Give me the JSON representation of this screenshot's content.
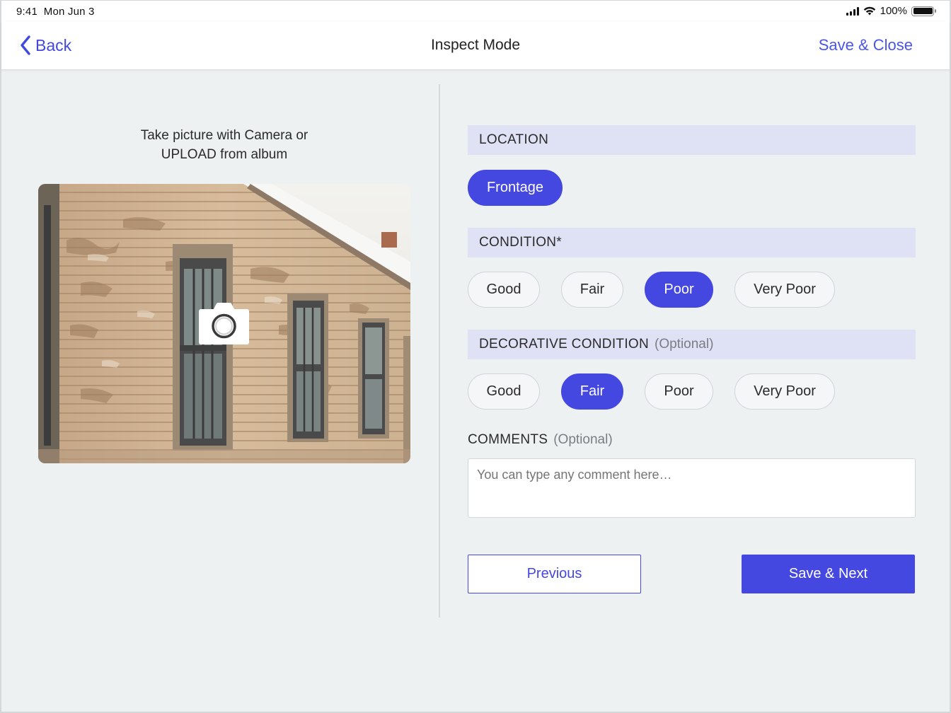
{
  "status_bar": {
    "time": "9:41",
    "date": "Mon Jun 3",
    "battery_percent": "100%",
    "icons": [
      "cellular-signal-icon",
      "wifi-icon",
      "battery-icon"
    ]
  },
  "nav": {
    "back_label": "Back",
    "title": "Inspect Mode",
    "save_close_label": "Save & Close"
  },
  "upload": {
    "instruction_line1": "Take picture with Camera or",
    "instruction_line2": "UPLOAD from album",
    "camera_icon": "camera-icon"
  },
  "location": {
    "heading": "LOCATION",
    "options": [
      {
        "label": "Frontage",
        "selected": true
      }
    ]
  },
  "condition": {
    "heading": "CONDITION*",
    "options": [
      {
        "label": "Good",
        "selected": false
      },
      {
        "label": "Fair",
        "selected": false
      },
      {
        "label": "Poor",
        "selected": true
      },
      {
        "label": "Very Poor",
        "selected": false
      }
    ]
  },
  "decorative_condition": {
    "heading": "DECORATIVE CONDITION",
    "optional": "(Optional)",
    "options": [
      {
        "label": "Good",
        "selected": false
      },
      {
        "label": "Fair",
        "selected": true
      },
      {
        "label": "Poor",
        "selected": false
      },
      {
        "label": "Very Poor",
        "selected": false
      }
    ]
  },
  "comments": {
    "heading": "COMMENTS",
    "optional": "(Optional)",
    "placeholder": "You can type any comment here…",
    "value": ""
  },
  "actions": {
    "previous_label": "Previous",
    "save_next_label": "Save & Next"
  },
  "colors": {
    "accent": "#4447e0",
    "section_bg": "#dfe1f4",
    "page_bg": "#eef1f2"
  }
}
